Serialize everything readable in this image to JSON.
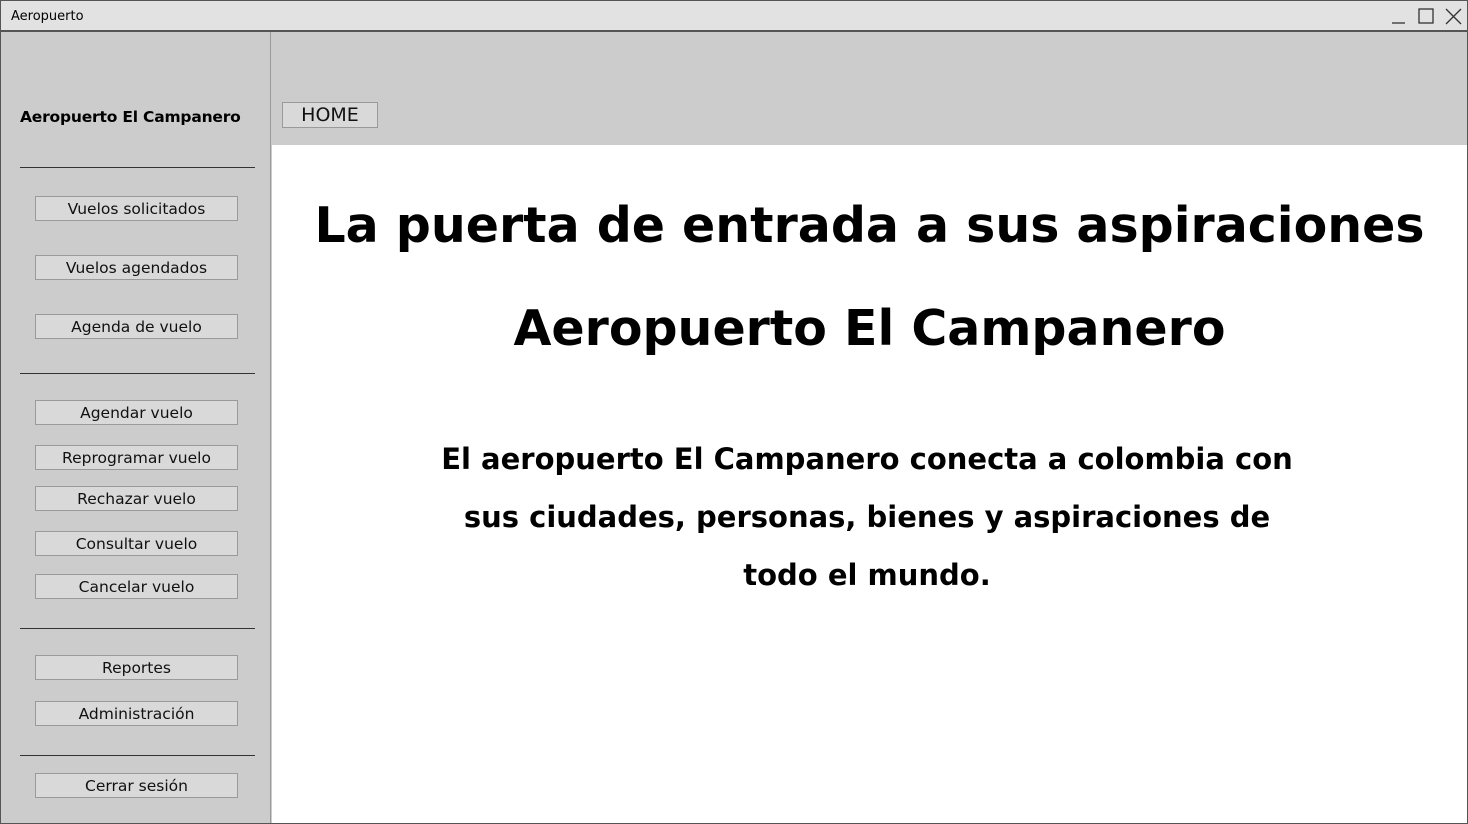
{
  "window": {
    "title": "Aeropuerto"
  },
  "sidebar": {
    "title": "Aeropuerto El Campanero",
    "groups": [
      [
        "Vuelos solicitados",
        "Vuelos agendados",
        "Agenda de vuelo"
      ],
      [
        "Agendar vuelo",
        "Reprogramar vuelo",
        "Rechazar vuelo",
        "Consultar vuelo",
        "Cancelar vuelo"
      ],
      [
        "Reportes",
        "Administración"
      ],
      [
        "Cerrar sesión"
      ]
    ]
  },
  "tabs": {
    "home": "HOME"
  },
  "main": {
    "headline": "La puerta de entrada a sus aspiraciones",
    "subheadline": "Aeropuerto El Campanero",
    "description": "El aeropuerto El Campanero conecta a colombia con sus ciudades, personas, bienes y aspiraciones de todo el mundo."
  },
  "icons": {
    "minimize": "minimize-icon",
    "maximize": "maximize-icon",
    "close": "close-icon"
  }
}
